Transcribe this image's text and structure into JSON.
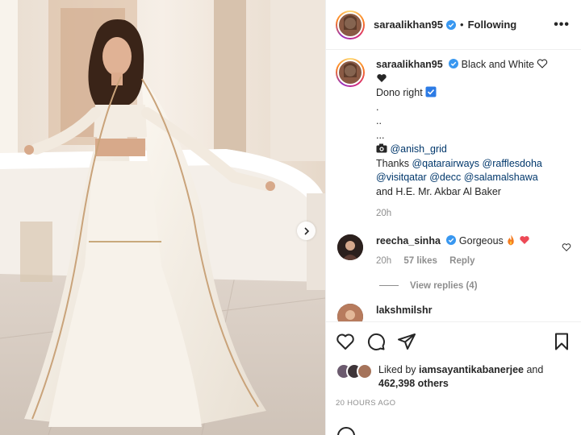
{
  "post": {
    "username": "saraalikhan95",
    "follow_status": "Following",
    "more_label": "•••",
    "caption": {
      "line1": "Black and White",
      "line2": "Dono right",
      "dots": [
        ".",
        "..",
        "..."
      ],
      "camera_mention": "@anish_grid",
      "thanks_prefix": "Thanks",
      "mentions": [
        "@qatarairways",
        "@rafflesdoha",
        "@visitqatar",
        "@decc",
        "@salamalshawa"
      ],
      "end_text": "and H.E. Mr. Akbar Al Baker",
      "time": "20h"
    },
    "comments": [
      {
        "username": "reecha_sinha",
        "text": "Gorgeous",
        "time": "20h",
        "likes": "57 likes",
        "reply": "Reply",
        "view_replies": "View replies (4)"
      },
      {
        "username": "lakshmilshr"
      }
    ],
    "liked_by_prefix": "Liked by",
    "liked_by_user": "iamsayantikabanerjee",
    "liked_by_and": "and",
    "others_count": "462,398 others",
    "posted_ago": "20 HOURS AGO"
  },
  "icons": {
    "like": "heart-icon",
    "comment": "comment-icon",
    "share": "share-icon",
    "save": "bookmark-icon",
    "next": "chevron-right-icon",
    "verified": "verified-badge-icon"
  },
  "colors": {
    "link": "#00376b",
    "muted": "#8e8e8e",
    "verified": "#3897f0",
    "text": "#262626"
  }
}
